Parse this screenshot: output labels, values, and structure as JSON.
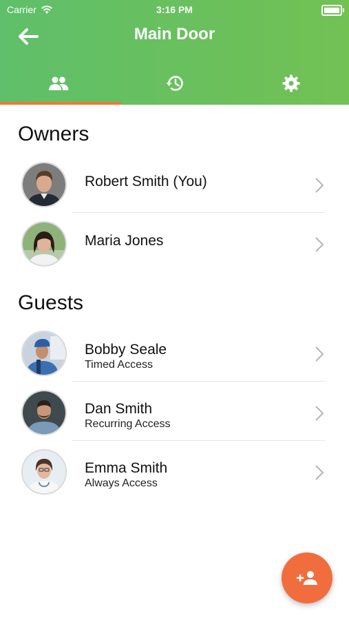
{
  "status_bar": {
    "carrier": "Carrier",
    "time": "3:16 PM"
  },
  "header": {
    "title": "Main Door"
  },
  "tabs": [
    {
      "icon": "people-icon",
      "active": true
    },
    {
      "icon": "history-icon",
      "active": false
    },
    {
      "icon": "gear-icon",
      "active": false
    }
  ],
  "owners": {
    "title": "Owners",
    "items": [
      {
        "name": "Robert Smith (You)"
      },
      {
        "name": "Maria Jones"
      }
    ]
  },
  "guests": {
    "title": "Guests",
    "items": [
      {
        "name": "Bobby Seale",
        "access": "Timed Access"
      },
      {
        "name": "Dan Smith",
        "access": "Recurring Access"
      },
      {
        "name": "Emma Smith",
        "access": "Always Access"
      }
    ]
  },
  "fab": {
    "icon": "add-person-icon"
  },
  "colors": {
    "header_green": "#6cc15c",
    "accent_orange": "#f07a34",
    "fab_orange": "#f26d3d"
  }
}
